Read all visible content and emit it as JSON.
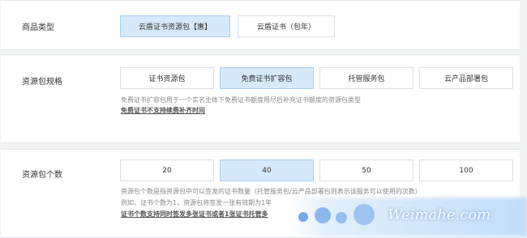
{
  "product_type": {
    "label": "商品类型",
    "options": [
      "云盾证书资源包【惠】",
      "云盾证书（包年）"
    ],
    "selected": 0
  },
  "package_spec": {
    "label": "资源包规格",
    "options": [
      "证书资源包",
      "免费证书扩容包",
      "托管服务包",
      "云产品部署包"
    ],
    "selected": 1,
    "description": "免费证书扩容包用于一个实名主体下免费证书额度用尽后补充证书额度的资源包类型",
    "note": "免费证书不支持续费补齐时间"
  },
  "package_count": {
    "label": "资源包个数",
    "options": [
      "20",
      "40",
      "50",
      "100"
    ],
    "selected": 1,
    "description_1": "资源包个数是指资源包中可以签发的证书数量（托管服务包/云产品部署包则表示该服务可以使用的次数）",
    "description_2": "例如，证书个数为1，资源包将签发一张有效期为1年",
    "note": "证书个数支持同时签发多张证书或者1张证书托管多"
  },
  "watermark": "Weimahe.com"
}
